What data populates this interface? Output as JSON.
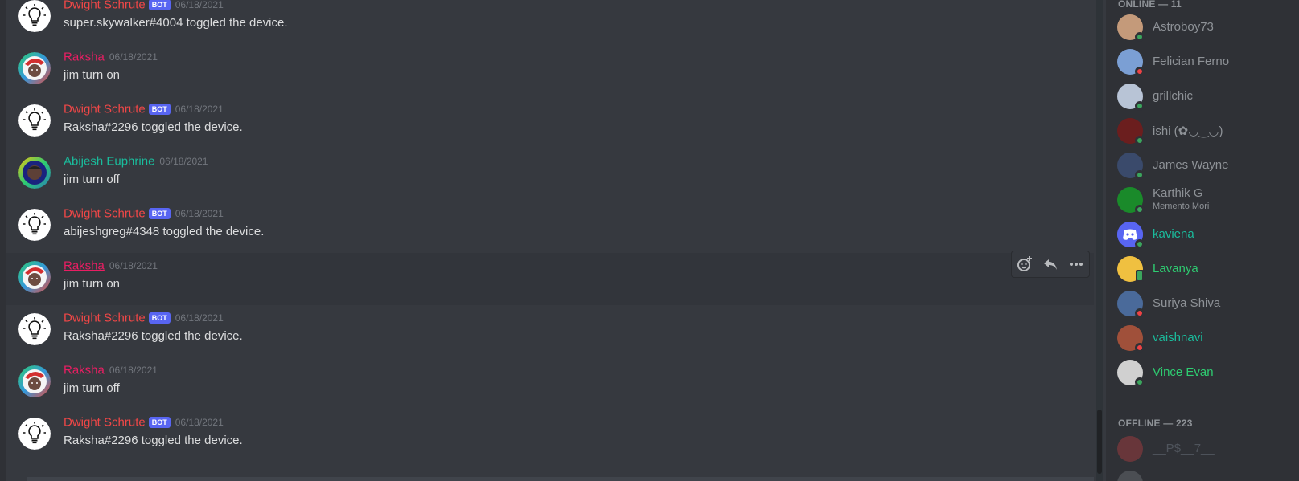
{
  "chat": {
    "messages": [
      {
        "author": "Dwight Schrute",
        "bot": true,
        "bot_label": "BOT",
        "time": "06/18/2021",
        "text": "super.skywalker#4004 toggled the device.",
        "color": "#f04747",
        "avatar": "bulb-icon"
      },
      {
        "author": "Raksha",
        "bot": false,
        "time": "06/18/2021",
        "text": "jim turn on",
        "color": "#e91e63",
        "avatar": "avatar-raksha"
      },
      {
        "author": "Dwight Schrute",
        "bot": true,
        "bot_label": "BOT",
        "time": "06/18/2021",
        "text": "Raksha#2296 toggled the device.",
        "color": "#f04747",
        "avatar": "bulb-icon"
      },
      {
        "author": "Abijesh Euphrine",
        "bot": false,
        "time": "06/18/2021",
        "text": "jim turn off",
        "color": "#1abc9c",
        "avatar": "avatar-abijesh"
      },
      {
        "author": "Dwight Schrute",
        "bot": true,
        "bot_label": "BOT",
        "time": "06/18/2021",
        "text": "abijeshgreg#4348 toggled the device.",
        "color": "#f04747",
        "avatar": "bulb-icon"
      },
      {
        "author": "Raksha",
        "bot": false,
        "time": "06/18/2021",
        "text": "jim turn on",
        "color": "#e91e63",
        "avatar": "avatar-raksha"
      },
      {
        "author": "Dwight Schrute",
        "bot": true,
        "bot_label": "BOT",
        "time": "06/18/2021",
        "text": "Raksha#2296 toggled the device.",
        "color": "#f04747",
        "avatar": "bulb-icon"
      },
      {
        "author": "Raksha",
        "bot": false,
        "time": "06/18/2021",
        "text": "jim turn off",
        "color": "#e91e63",
        "avatar": "avatar-raksha"
      },
      {
        "author": "Dwight Schrute",
        "bot": true,
        "bot_label": "BOT",
        "time": "06/18/2021",
        "text": "Raksha#2296 toggled the device.",
        "color": "#f04747",
        "avatar": "bulb-icon"
      }
    ],
    "toolbar": {
      "icons": [
        "add-reaction-icon",
        "reply-icon",
        "more-options-icon"
      ]
    }
  },
  "members": {
    "online_title": "ONLINE — 11",
    "offline_title": "OFFLINE — 223",
    "online": [
      {
        "name": "Astroboy73",
        "status": "online",
        "name_color": "#8e9297",
        "avatar_color": "#c49a7a"
      },
      {
        "name": "Felician Ferno",
        "status": "dnd",
        "name_color": "#8e9297",
        "avatar_color": "#7b9fd4"
      },
      {
        "name": "grillchic",
        "status": "online",
        "name_color": "#8e9297",
        "avatar_color": "#b8c4d6"
      },
      {
        "name": "ishi (✿◡‿◡)",
        "status": "online",
        "name_color": "#8e9297",
        "avatar_color": "#6b1e1e"
      },
      {
        "name": "James Wayne",
        "status": "online",
        "name_color": "#8e9297",
        "avatar_color": "#3a4a6b"
      },
      {
        "name": "Karthik G",
        "subtitle": "Memento Mori",
        "status": "online",
        "name_color": "#8e9297",
        "avatar_color": "#1a8a2a"
      },
      {
        "name": "kaviena",
        "status": "online",
        "name_color": "#1abc9c",
        "avatar_color": "#5865f2"
      },
      {
        "name": "Lavanya",
        "status": "mobile",
        "name_color": "#2ecc71",
        "avatar_color": "#f0c040"
      },
      {
        "name": "Suriya Shiva",
        "status": "dnd",
        "name_color": "#8e9297",
        "avatar_color": "#4a6a9a"
      },
      {
        "name": "vaishnavi",
        "status": "dnd",
        "name_color": "#1abc9c",
        "avatar_color": "#a0503a"
      },
      {
        "name": "Vince Evan",
        "status": "online",
        "name_color": "#2ecc71",
        "avatar_color": "#d0d0d0"
      }
    ],
    "offline": [
      {
        "name": "__P$__7__",
        "avatar_color": "#ed4245"
      },
      {
        "name": "",
        "avatar_color": "#8e9297"
      }
    ]
  }
}
